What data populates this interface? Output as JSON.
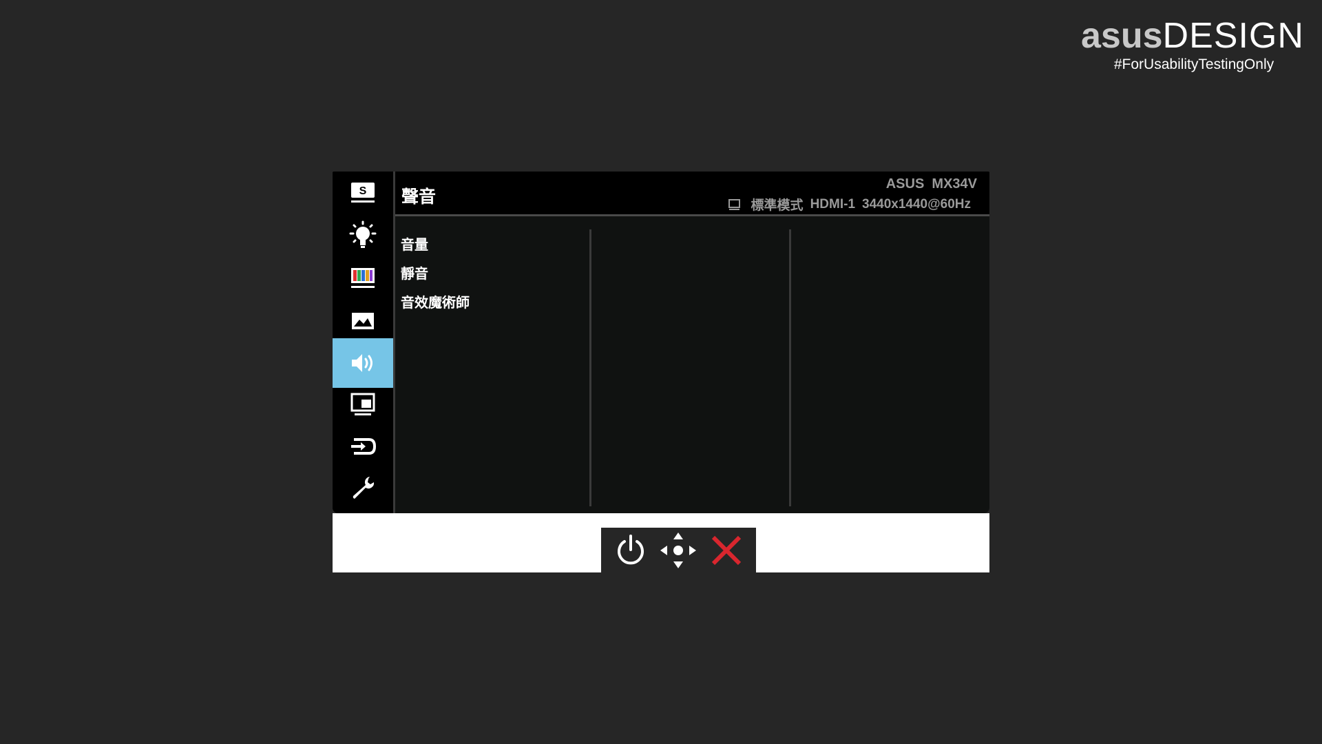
{
  "brand": {
    "logo_asus": "asus",
    "logo_design": "DESIGN",
    "tagline": "#ForUsabilityTestingOnly"
  },
  "osd": {
    "title": "聲音",
    "model": "ASUS  MX34V",
    "status": {
      "mode": "標準模式",
      "input": "HDMI-1",
      "resolution": "3440x1440@60Hz"
    },
    "sidebar": [
      {
        "name": "splendid",
        "icon": "splendid-s-icon",
        "active": false
      },
      {
        "name": "brightness",
        "icon": "brightness-bulb-icon",
        "active": false
      },
      {
        "name": "color",
        "icon": "color-bars-icon",
        "active": false
      },
      {
        "name": "image",
        "icon": "image-landscape-icon",
        "active": false
      },
      {
        "name": "sound",
        "icon": "speaker-icon",
        "active": true
      },
      {
        "name": "pip",
        "icon": "pip-monitor-icon",
        "active": false
      },
      {
        "name": "input-select",
        "icon": "input-select-icon",
        "active": false
      },
      {
        "name": "system-setup",
        "icon": "wrench-icon",
        "active": false
      }
    ],
    "menu_items": [
      "音量",
      "靜音",
      "音效魔術師"
    ],
    "accent_color": "#76c5e7"
  },
  "keys": [
    {
      "name": "power",
      "icon": "power-icon"
    },
    {
      "name": "navigate",
      "icon": "five-way-navigation-icon"
    },
    {
      "name": "close",
      "icon": "close-x-icon",
      "color": "#d9262e"
    }
  ]
}
